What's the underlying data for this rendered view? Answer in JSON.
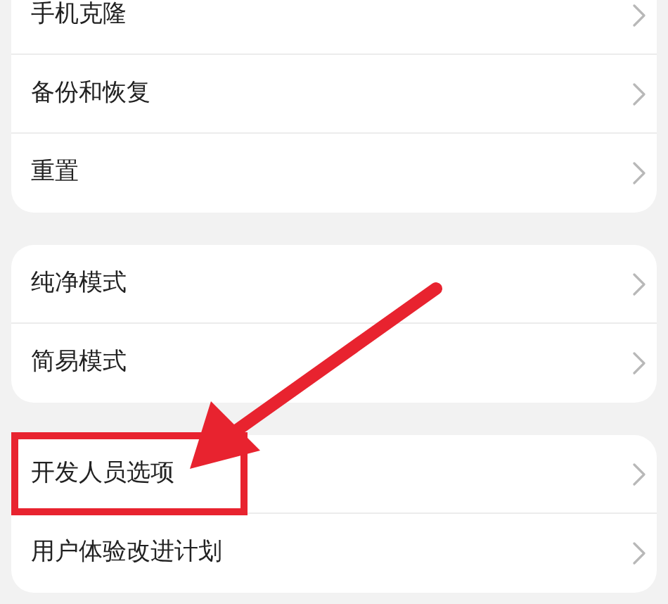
{
  "groups": [
    {
      "items": [
        {
          "label": "手机克隆"
        },
        {
          "label": "备份和恢复"
        },
        {
          "label": "重置"
        }
      ]
    },
    {
      "items": [
        {
          "label": "纯净模式"
        },
        {
          "label": "简易模式"
        }
      ]
    },
    {
      "items": [
        {
          "label": "开发人员选项"
        },
        {
          "label": "用户体验改进计划"
        }
      ]
    }
  ]
}
